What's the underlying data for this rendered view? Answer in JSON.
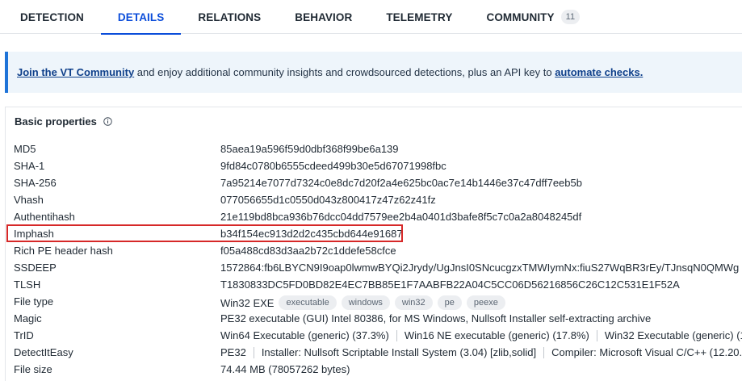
{
  "tabs": [
    {
      "label": "DETECTION"
    },
    {
      "label": "DETAILS"
    },
    {
      "label": "RELATIONS"
    },
    {
      "label": "BEHAVIOR"
    },
    {
      "label": "TELEMETRY"
    },
    {
      "label": "COMMUNITY",
      "count": "11"
    }
  ],
  "active_tab": "DETAILS",
  "banner": {
    "join_link": "Join the VT Community",
    "middle_text": " and enjoy additional community insights and crowdsourced detections, plus an API key to ",
    "automate_link": "automate checks."
  },
  "basic_properties": {
    "title": "Basic properties",
    "info_icon": "info-circle-icon",
    "rows": {
      "md5": {
        "label": "MD5",
        "value": "85aea19a596f59d0dbf368f99be6a139"
      },
      "sha1": {
        "label": "SHA-1",
        "value": "9fd84c0780b6555cdeed499b30e5d67071998fbc"
      },
      "sha256": {
        "label": "SHA-256",
        "value": "7a95214e7077d7324c0e8dc7d20f2a4e625bc0ac7e14b1446e37c47dff7eeb5b"
      },
      "vhash": {
        "label": "Vhash",
        "value": "077056655d1c0550d043z800417z47z62z41fz"
      },
      "authentihash": {
        "label": "Authentihash",
        "value": "21e119bd8bca936b76dcc04dd7579ee2b4a0401d3bafe8f5c7c0a2a8048245df"
      },
      "imphash": {
        "label": "Imphash",
        "value": "b34f154ec913d2d2c435cbd644e91687"
      },
      "rich_pe": {
        "label": "Rich PE header hash",
        "value": "f05a488cd83d3aa2b72c1ddefe58cfce"
      },
      "ssdeep": {
        "label": "SSDEEP",
        "value": "1572864:fb6LBYCN9I9oap0lwmwBYQi2Jrydy/UgJnsI0SNcucgzxTMWIymNx:fiuS27WqBR3rEy/TJnsqN0QMWg"
      },
      "tlsh": {
        "label": "TLSH",
        "value": "T1830833DC5FD0BD82E4EC7BB85E1F7AABFB22A04C5CC06D56216856C26C12C531E1F52A"
      },
      "file_type": {
        "label": "File type",
        "value": "Win32 EXE",
        "tags": [
          "executable",
          "windows",
          "win32",
          "pe",
          "peexe"
        ]
      },
      "magic": {
        "label": "Magic",
        "value": "PE32 executable (GUI) Intel 80386, for MS Windows, Nullsoft Installer self-extracting archive"
      },
      "trid": {
        "label": "TrID",
        "items": [
          "Win64 Executable (generic) (37.3%)",
          "Win16 NE executable (generic) (17.8%)",
          "Win32 Executable (generic) (15"
        ]
      },
      "detectiteasy": {
        "label": "DetectItEasy",
        "items": [
          "PE32",
          "Installer: Nullsoft Scriptable Install System (3.04) [zlib,solid]",
          "Compiler: Microsoft Visual C/C++ (12.20."
        ]
      },
      "file_size": {
        "label": "File size",
        "value": "74.44 MB (78057262 bytes)"
      }
    }
  },
  "highlight_color": "#d62828",
  "accent_color": "#0b4dda"
}
